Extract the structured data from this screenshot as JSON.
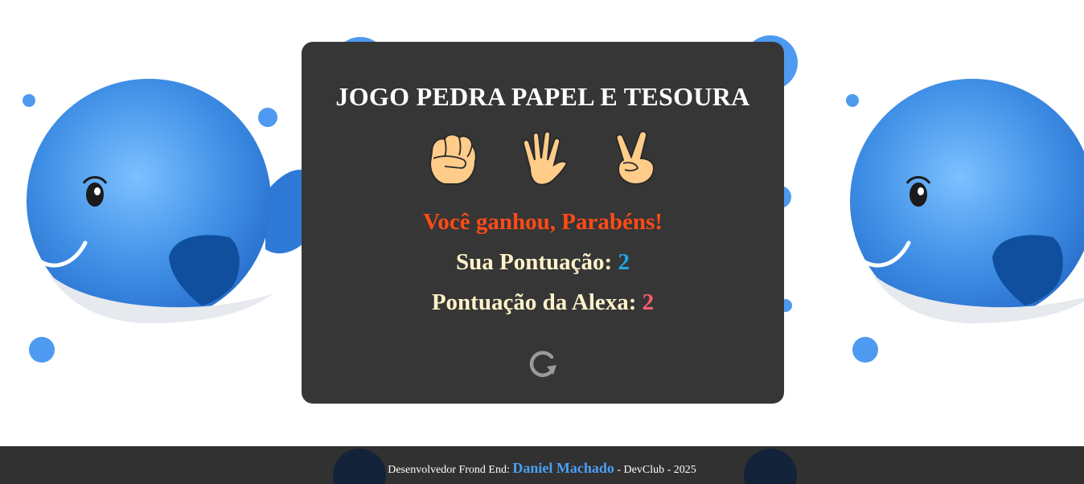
{
  "game": {
    "title": "JOGO PEDRA PAPEL E TESOURA",
    "choices": [
      {
        "id": "pedra",
        "icon": "fist-rock-icon"
      },
      {
        "id": "papel",
        "icon": "open-hand-paper-icon"
      },
      {
        "id": "tesoura",
        "icon": "victory-hand-scissors-icon"
      }
    ],
    "result_message": "Você ganhou, Parabéns!",
    "user_score_label": "Sua Pontuação:",
    "user_score": "2",
    "alexa_score_label": "Pontuação da Alexa:",
    "alexa_score": "2",
    "restart_icon": "restart-icon"
  },
  "footer": {
    "prefix": "Desenvolvedor Frond End:",
    "author": "Daniel Machado",
    "suffix": "- DevClub - 2025"
  },
  "colors": {
    "card_bg": "#363636",
    "title": "#ffffff",
    "result": "#ff4a16",
    "score_label": "#fff3c9",
    "user_score": "#1ea7e8",
    "alexa_score": "#ff5d6c",
    "footer_bg": "#313131",
    "footer_author": "#4a9ff5",
    "whale": "#3f8fe6"
  }
}
